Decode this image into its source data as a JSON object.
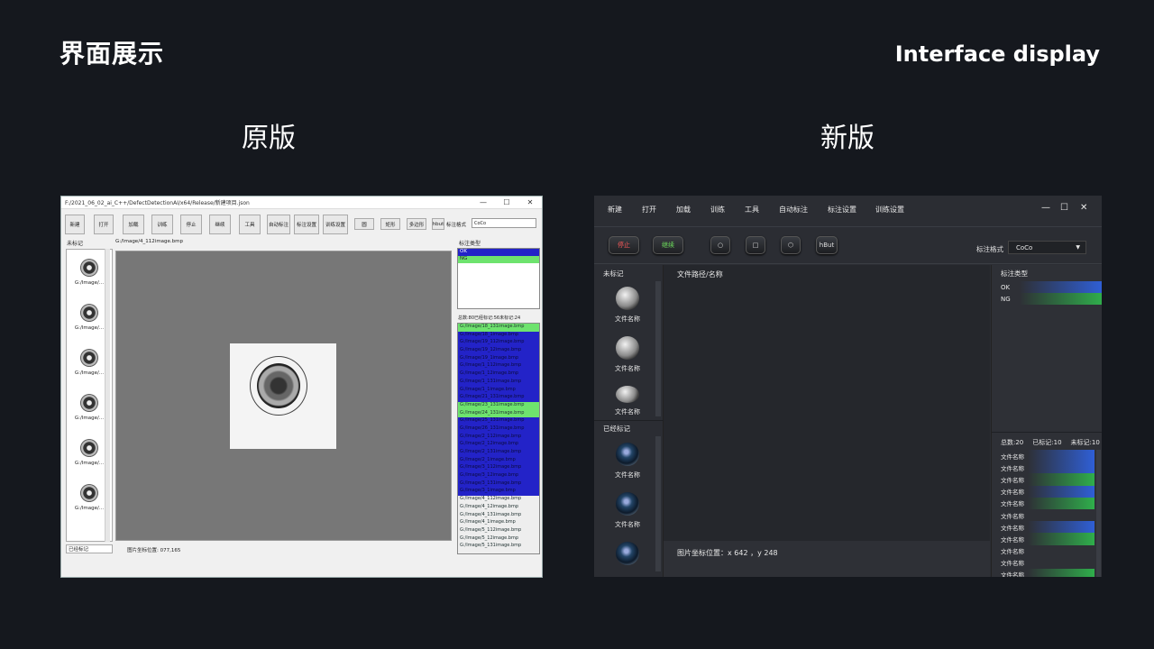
{
  "slide": {
    "title": "界面展示",
    "title_en": "Interface display",
    "label_old": "原版",
    "label_new": "新版"
  },
  "old_ui": {
    "window_title": "F:/2021_06_02_ai_C++/DefectDetectionAI/x64/Release/新建项目.json",
    "window_controls": [
      "—",
      "☐",
      "✕"
    ],
    "toolbar_buttons": [
      "新建",
      "打开",
      "加载",
      "训练",
      "停止",
      "继续",
      "工具",
      "自动标注",
      "标注设置",
      "训练设置"
    ],
    "shape_buttons": [
      "圆",
      "矩形",
      "多边形",
      "hbut"
    ],
    "format_label": "标注格式",
    "format_value": "CoCo",
    "unmarked_label": "未标记",
    "marked_label": "已经标记",
    "path": "G:/Image/4_112image.bmp",
    "thumb_caption": "G:/Image/...",
    "coord_text": "图片坐标位置: 077,165",
    "types_title": "标注类型",
    "types": [
      "OK",
      "NG"
    ],
    "counts": "总数:80已经标记:56未标记:24",
    "files": [
      "G:/Image/18_131image.bmp",
      "G:/Image/18_1image.bmp",
      "G:/Image/19_112image.bmp",
      "G:/Image/19_12image.bmp",
      "G:/Image/19_1image.bmp",
      "G:/Image/1_112image.bmp",
      "G:/Image/1_12image.bmp",
      "G:/Image/1_131image.bmp",
      "G:/Image/1_1image.bmp",
      "G:/Image/21_131image.bmp",
      "G:/Image/23_131image.bmp",
      "G:/Image/24_131image.bmp",
      "G:/Image/25_131image.bmp",
      "G:/Image/26_131image.bmp",
      "G:/Image/2_112image.bmp",
      "G:/Image/2_12image.bmp",
      "G:/Image/2_131image.bmp",
      "G:/Image/2_1image.bmp",
      "G:/Image/3_112image.bmp",
      "G:/Image/3_12image.bmp",
      "G:/Image/3_131image.bmp",
      "G:/Image/3_1image.bmp",
      "G:/Image/4_112image.bmp",
      "G:/Image/4_12image.bmp",
      "G:/Image/4_131image.bmp",
      "G:/Image/4_1image.bmp",
      "G:/Image/5_112image.bmp",
      "G:/Image/5_12image.bmp",
      "G:/Image/5_131image.bmp"
    ],
    "file_status": [
      "ok",
      "ng",
      "ng",
      "ng",
      "ng",
      "ng",
      "ng",
      "ng",
      "ng",
      "ng",
      "ok",
      "ok",
      "ng",
      "ng",
      "ng",
      "ng",
      "ng",
      "ng",
      "ng",
      "ng",
      "ng",
      "ng",
      "none",
      "none",
      "none",
      "none",
      "none",
      "none",
      "none"
    ]
  },
  "new_ui": {
    "menu": [
      "新建",
      "打开",
      "加载",
      "训练",
      "工具",
      "自动标注",
      "标注设置",
      "训练设置"
    ],
    "window_controls": [
      "—",
      "☐",
      "✕"
    ],
    "stop_label": "停止",
    "continue_label": "继续",
    "shape_buttons": [
      "○",
      "□",
      "⬡",
      "hBut"
    ],
    "format_label": "标注格式",
    "format_value": "CoCo",
    "unmarked_label": "未标记",
    "marked_label": "已经标记",
    "thumb_caption": "文件名称",
    "path_label": "文件路径/名称",
    "coord_text": "图片坐标位置：x 642 ，y 248",
    "types_title": "标注类型",
    "types": [
      "OK",
      "NG"
    ],
    "count_total": "总数:20",
    "count_marked": "已标记:10",
    "count_unmarked": "未标记:10",
    "file_label": "文件名称",
    "file_status": [
      "blue",
      "blue",
      "green",
      "blue",
      "green",
      "none",
      "blue",
      "green",
      "none",
      "none",
      "green",
      "green",
      "blue",
      "none",
      "green",
      "blue",
      "none"
    ]
  },
  "colors": {
    "ok_blue": "#2323c8",
    "ng_green": "#6ee36e",
    "new_blue": "#2f5fd6",
    "new_green": "#2fae4b"
  }
}
